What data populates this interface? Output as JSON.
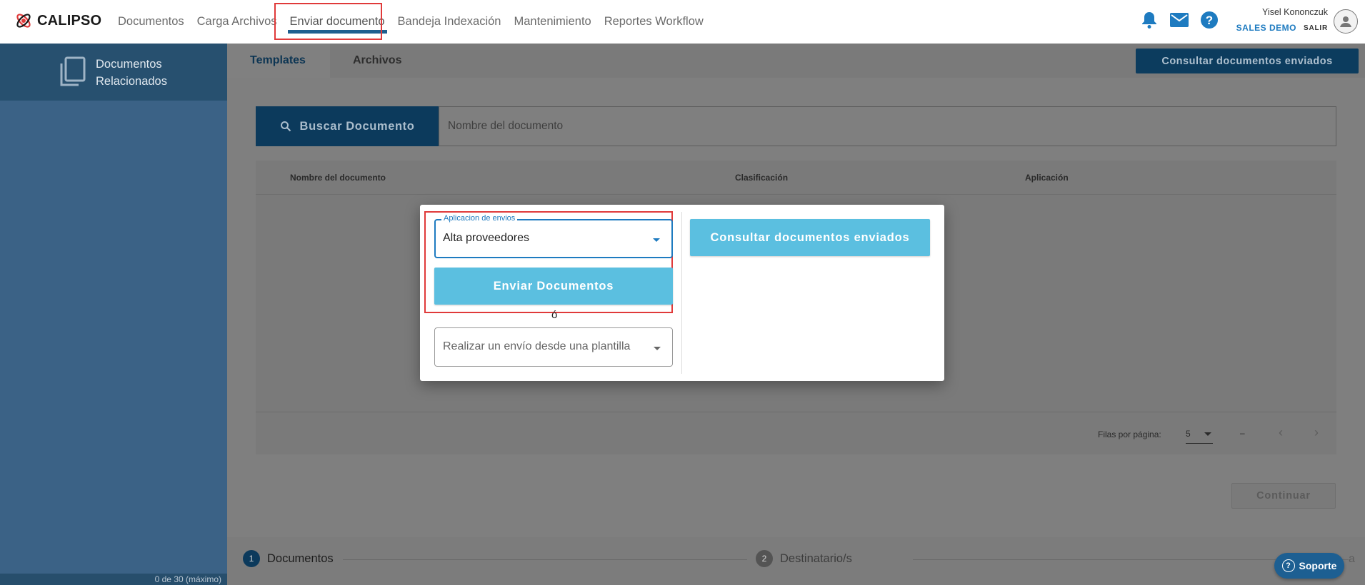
{
  "brand": {
    "name": "CALIPSO"
  },
  "nav": {
    "items": [
      {
        "label": "Documentos"
      },
      {
        "label": "Carga Archivos"
      },
      {
        "label": "Enviar documento",
        "active": true
      },
      {
        "label": "Bandeja Indexación"
      },
      {
        "label": "Mantenimiento"
      },
      {
        "label": "Reportes Workflow"
      }
    ]
  },
  "header": {
    "icons": [
      "bell-icon",
      "mail-icon",
      "help-icon"
    ],
    "user_name": "Yisel Kononczuk",
    "company": "SALES DEMO",
    "logout": "SALIR"
  },
  "sidebar": {
    "title": "Documentos Relacionados",
    "footer": "0 de 30 (máximo)"
  },
  "main": {
    "tabs": [
      {
        "label": "Templates",
        "active": true
      },
      {
        "label": "Archivos"
      }
    ],
    "top_button": "Consultar documentos enviados",
    "search": {
      "button": "Buscar Documento",
      "placeholder": "Nombre del documento"
    },
    "table": {
      "columns": [
        "Nombre del documento",
        "Clasificación",
        "Aplicación"
      ],
      "rows_per_page_label": "Filas por página:",
      "rows_per_page": "5",
      "range": "–"
    },
    "continue_button": "Continuar",
    "stepper": [
      {
        "num": "1",
        "label": "Documentos"
      },
      {
        "num": "2",
        "label": "Destinatario/s"
      }
    ],
    "stepper_peek": "a"
  },
  "modal": {
    "app_select": {
      "legend": "Aplicacion de envios",
      "value": "Alta proveedores"
    },
    "send_button": "Enviar Documentos",
    "or_text": "ó",
    "template_select": {
      "placeholder": "Realizar un envío desde una plantilla"
    },
    "consult_button": "Consultar documentos enviados"
  },
  "support": {
    "label": "Soporte"
  },
  "colors": {
    "primary_dark": "#0c3a5c",
    "accent_blue": "#1e7bc0",
    "button_light_blue": "#5bbfe0",
    "sidebar": "#3b6286",
    "highlight_red": "#e03a3a"
  }
}
